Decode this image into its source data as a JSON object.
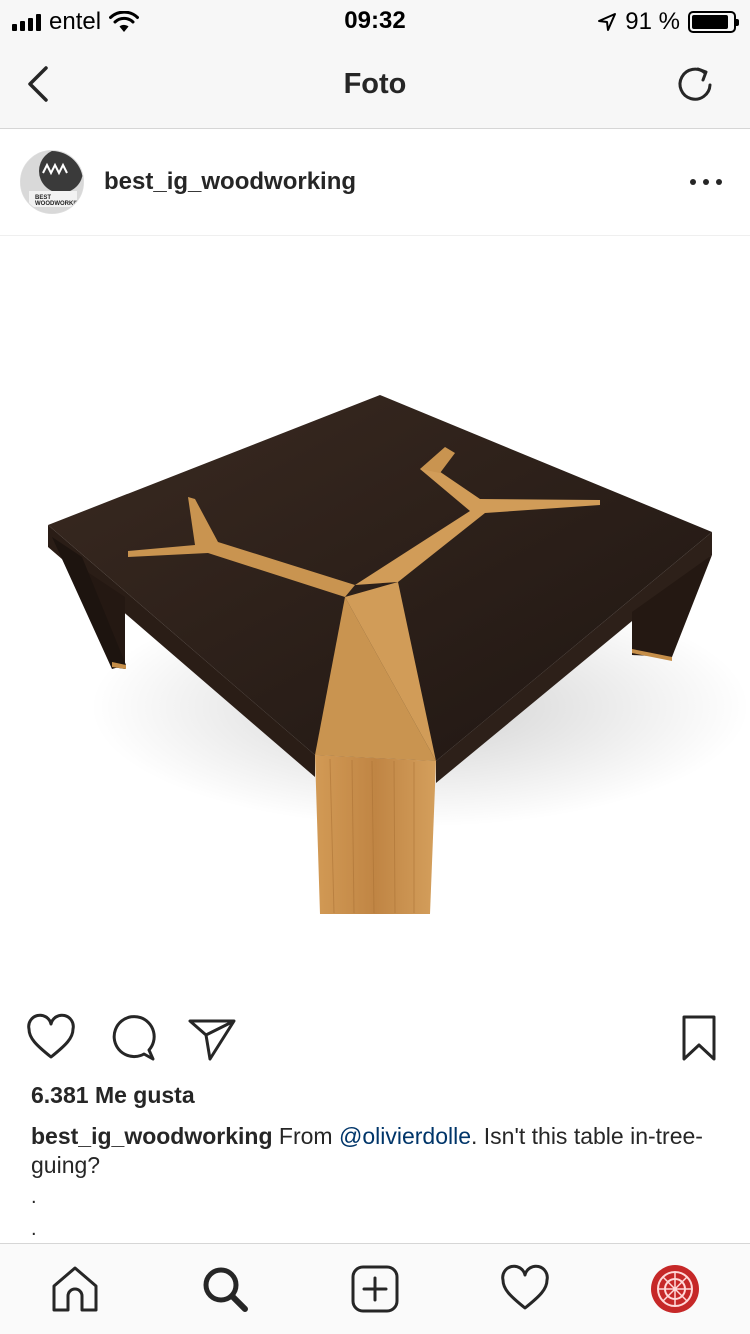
{
  "status_bar": {
    "carrier": "entel",
    "time": "09:32",
    "battery_percent": "91 %",
    "battery_level": 0.91,
    "signal_icon": "cellular-signal-icon",
    "wifi_icon": "wifi-icon",
    "location_icon": "location-arrow-icon",
    "battery_icon": "battery-icon"
  },
  "nav": {
    "title": "Foto",
    "back_icon": "chevron-left-icon",
    "refresh_icon": "refresh-icon"
  },
  "post": {
    "username": "best_ig_woodworking",
    "avatar_text": "BEST WOODWORKING",
    "more_icon": "more-horizontal-icon",
    "likes": "6.381 Me gusta",
    "caption": {
      "username": "best_ig_woodworking",
      "prefix": "From ",
      "mention": "@olivierdolle",
      "text": ".  Isn't this table in-tree-guing?",
      "dot_1": ".",
      "dot_2": "."
    },
    "actions": {
      "like_icon": "heart-icon",
      "comment_icon": "comment-icon",
      "share_icon": "send-icon",
      "save_icon": "bookmark-icon"
    }
  },
  "tab_bar": {
    "home_icon": "home-icon",
    "search_icon": "search-icon",
    "add_icon": "add-post-icon",
    "activity_icon": "heart-icon",
    "profile_icon": "profile-avatar-icon"
  },
  "colors": {
    "bar_background": "#f7f7f7",
    "text": "#262626",
    "mention": "#003569",
    "table_dark": "#2a1e17",
    "table_oak": "#c58e49"
  }
}
